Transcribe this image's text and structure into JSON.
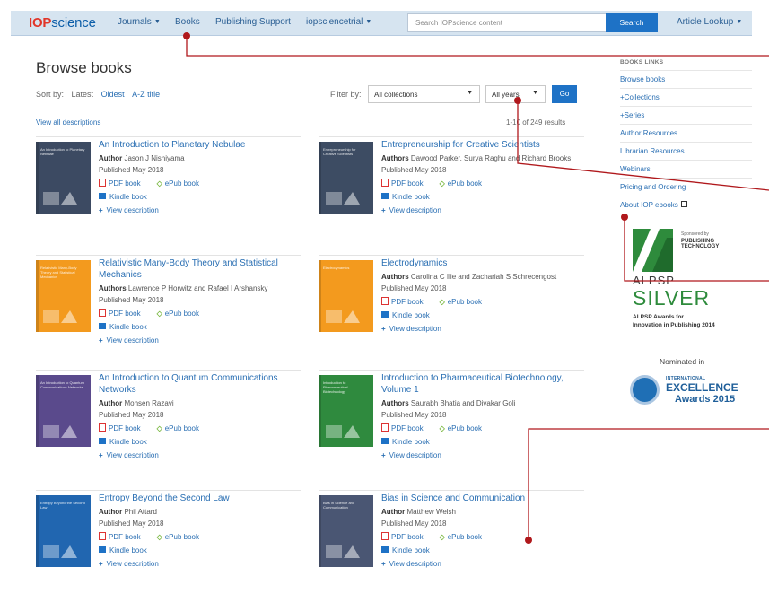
{
  "nav": {
    "logo_bold": "IOP",
    "logo_rest": "science",
    "journals": "Journals",
    "books": "Books",
    "publishing_support": "Publishing Support",
    "account": "iopsciencetrial",
    "search_placeholder": "Search IOPscience content",
    "search_button": "Search",
    "article_lookup": "Article Lookup"
  },
  "page": {
    "title": "Browse books",
    "sort_label": "Sort by:",
    "sort_latest": "Latest",
    "sort_oldest": "Oldest",
    "sort_az": "A-Z title",
    "filter_label": "Filter by:",
    "collection_select": "All collections",
    "years_select": "All years",
    "go_button": "Go",
    "view_all": "View all descriptions",
    "results": "1-10 of 249 results"
  },
  "books": [
    {
      "title": "An Introduction to Planetary Nebulae",
      "authors_label": "Author",
      "authors": "Jason J Nishiyama",
      "published": "Published May 2018",
      "pdf": "PDF book",
      "epub": "ePub book",
      "kindle": "Kindle book",
      "desc": "View description",
      "cover_title": "An Introduction to Planetary Nebulae",
      "cover_color": "#3c4a62"
    },
    {
      "title": "Entrepreneurship for Creative Scientists",
      "authors_label": "Authors",
      "authors": "Dawood Parker, Surya Raghu and Richard Brooks",
      "published": "Published May 2018",
      "pdf": "PDF book",
      "epub": "ePub book",
      "kindle": "Kindle book",
      "desc": "View description",
      "cover_title": "Entrepreneurship for Creative Scientists",
      "cover_color": "#3d4c63"
    },
    {
      "title": "Relativistic Many-Body Theory and Statistical Mechanics",
      "authors_label": "Authors",
      "authors": "Lawrence P Horwitz and Rafael I Arshansky",
      "published": "Published May 2018",
      "pdf": "PDF book",
      "epub": "ePub book",
      "kindle": "Kindle book",
      "desc": "View description",
      "cover_title": "Relativistic Many-Body Theory and Statistical Mechanics",
      "cover_color": "#f39a1e"
    },
    {
      "title": "Electrodynamics",
      "authors_label": "Authors",
      "authors": "Carolina C Ilie and Zachariah S Schrecengost",
      "published": "Published May 2018",
      "pdf": "PDF book",
      "epub": "ePub book",
      "kindle": "Kindle book",
      "desc": "View description",
      "cover_title": "Electrodynamics",
      "cover_color": "#f39a1e"
    },
    {
      "title": "An Introduction to Quantum Communications Networks",
      "authors_label": "Author",
      "authors": "Mohsen Razavi",
      "published": "Published May 2018",
      "pdf": "PDF book",
      "epub": "ePub book",
      "kindle": "Kindle book",
      "desc": "View description",
      "cover_title": "An Introduction to Quantum Communications Networks",
      "cover_color": "#5a4a8c"
    },
    {
      "title": "Introduction to Pharmaceutical Biotechnology, Volume 1",
      "authors_label": "Authors",
      "authors": "Saurabh Bhatia and Divakar Goli",
      "published": "Published May 2018",
      "pdf": "PDF book",
      "epub": "ePub book",
      "kindle": "Kindle book",
      "desc": "View description",
      "cover_title": "Introduction to Pharmaceutical Biotechnology",
      "cover_color": "#2f8a3e"
    },
    {
      "title": "Entropy Beyond the Second Law",
      "authors_label": "Author",
      "authors": "Phil Attard",
      "published": "Published May 2018",
      "pdf": "PDF book",
      "epub": "ePub book",
      "kindle": "Kindle book",
      "desc": "View description",
      "cover_title": "Entropy Beyond the Second Law",
      "cover_color": "#2166b0"
    },
    {
      "title": "Bias in Science and Communication",
      "authors_label": "Author",
      "authors": "Matthew Welsh",
      "published": "Published May 2018",
      "pdf": "PDF book",
      "epub": "ePub book",
      "kindle": "Kindle book",
      "desc": "View description",
      "cover_title": "Bias in Science and Communication",
      "cover_color": "#4a5673"
    }
  ],
  "sidebar": {
    "title": "BOOKS LINKS",
    "items": [
      "Browse books",
      "+Collections",
      "+Series",
      "Author Resources",
      "Librarian Resources",
      "Webinars",
      "Pricing and Ordering"
    ],
    "about": "About IOP ebooks"
  },
  "awards": {
    "alpsp_sponsored": "Sponsored by",
    "alpsp_sponsor": "PUBLISHING TECHNOLOGY",
    "alpsp_name": "ALPSP",
    "alpsp_level": "SILVER",
    "alpsp_desc_1": "ALPSP Awards for",
    "alpsp_desc_2": "Innovation in Publishing 2014",
    "nominated": "Nominated in",
    "excel_line1": "INTERNATIONAL",
    "excel_line2": "EXCELLENCE",
    "excel_line3": "Awards 2015"
  },
  "colors": {
    "accent": "#1e72c6",
    "link": "#2a6fb3",
    "annotation": "#b0181c"
  }
}
